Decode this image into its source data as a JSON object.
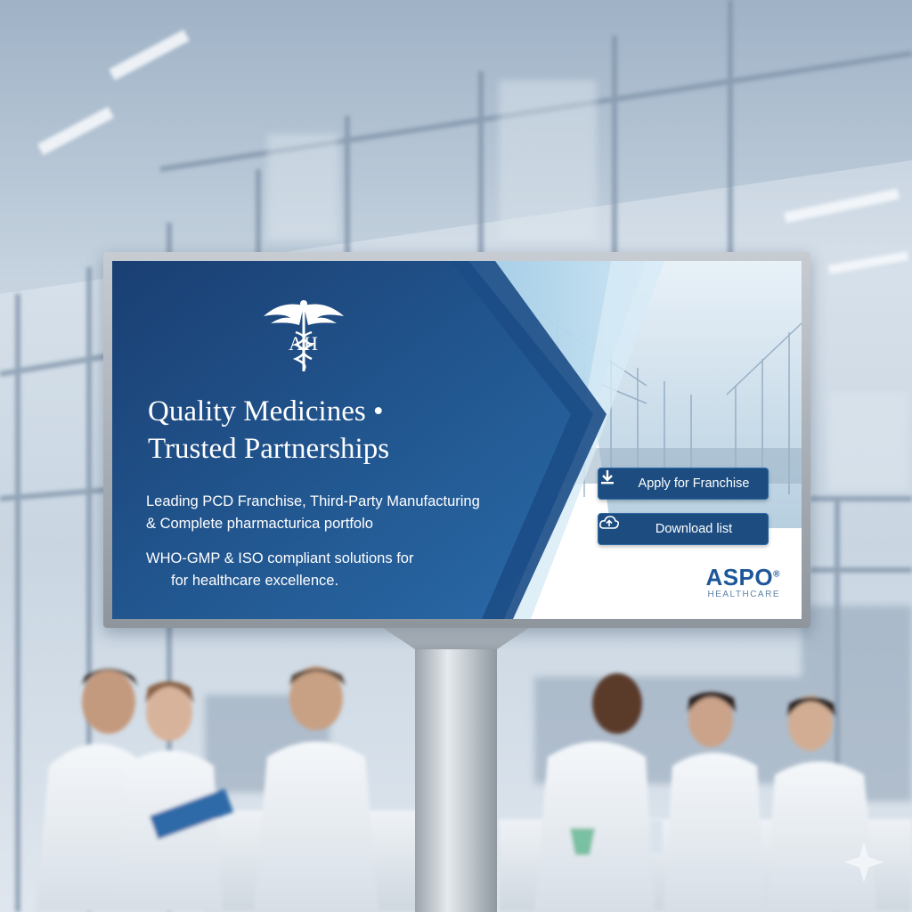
{
  "billboard": {
    "logo_initials": "AH",
    "headline": [
      "Quality Medicines •",
      "Trusted Partnerships"
    ],
    "subtitle": [
      "Leading PCD Franchise, Third-Party Manufacturing",
      "& Complete pharmacturica portfolo"
    ],
    "compliance": [
      "WHO-GMP & ISO compliant solutions for",
      "for healthcare excellence."
    ],
    "buttons": {
      "apply_label": "Apply for Franchise",
      "download_label": "Download list"
    },
    "brand": {
      "name": "ASPO",
      "mark": "®",
      "tagline": "HEALTHCARE"
    },
    "icons": [
      "caduceus-icon",
      "download-icon",
      "cloud-upload-icon",
      "sparkle-icon"
    ]
  },
  "colors": {
    "navy": "#1e4a80",
    "button": "#1d4d80",
    "light_blue": "#a9d0e8",
    "brand_blue": "#1e5799"
  }
}
